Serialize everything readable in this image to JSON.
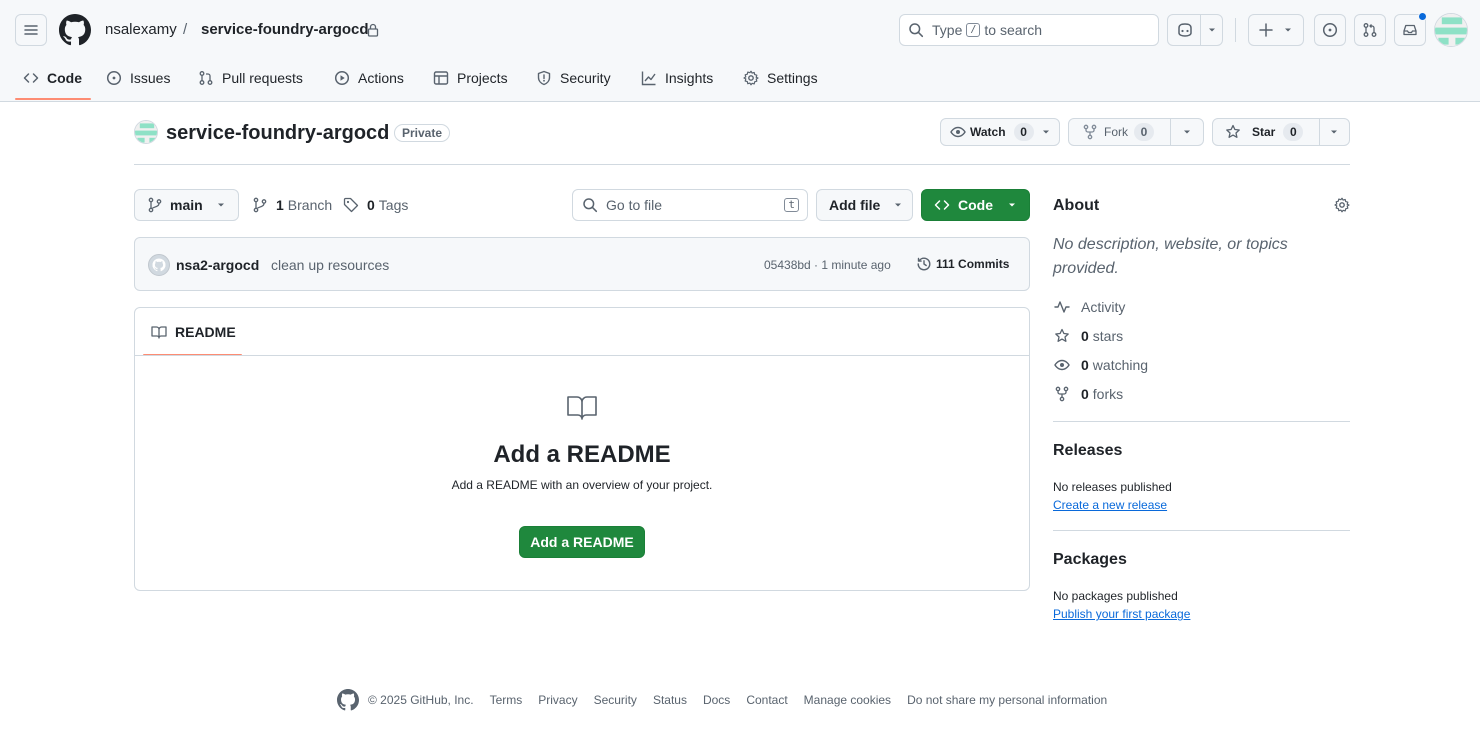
{
  "header": {
    "owner": "nsalexamy",
    "separator": "/",
    "repo": "service-foundry-argocd",
    "search_prefix": "Type",
    "search_key": "/",
    "search_suffix": "to search"
  },
  "nav": {
    "tabs": [
      {
        "label": "Code",
        "icon": "code-icon",
        "selected": true
      },
      {
        "label": "Issues",
        "icon": "issue-opened-icon"
      },
      {
        "label": "Pull requests",
        "icon": "git-pull-request-icon"
      },
      {
        "label": "Actions",
        "icon": "play-icon"
      },
      {
        "label": "Projects",
        "icon": "table-icon"
      },
      {
        "label": "Security",
        "icon": "shield-icon"
      },
      {
        "label": "Insights",
        "icon": "graph-icon"
      },
      {
        "label": "Settings",
        "icon": "gear-icon"
      }
    ]
  },
  "repo_header": {
    "name": "service-foundry-argocd",
    "visibility": "Private",
    "watch_label": "Watch",
    "watch_count": "0",
    "fork_label": "Fork",
    "fork_count": "0",
    "star_label": "Star",
    "star_count": "0"
  },
  "file_nav": {
    "branch": "main",
    "branch_count": "1",
    "branch_label": "Branch",
    "tag_count": "0",
    "tag_label": "Tags",
    "go_to_file_placeholder": "Go to file",
    "go_to_file_key": "t",
    "add_file_label": "Add file",
    "code_label": "Code"
  },
  "commit": {
    "author": "nsa2-argocd",
    "message": "clean up resources",
    "meta": "05438bd · 1 minute ago",
    "commits_label": "111 Commits"
  },
  "readme": {
    "tab_label": "README",
    "title": "Add a README",
    "description": "Add a README with an overview of your project.",
    "button_label": "Add a README"
  },
  "about": {
    "title": "About",
    "description": "No description, website, or topics provided.",
    "activity_label": "Activity",
    "stars_count": "0",
    "stars_label": "stars",
    "watching_count": "0",
    "watching_label": "watching",
    "forks_count": "0",
    "forks_label": "forks"
  },
  "releases": {
    "title": "Releases",
    "empty_text": "No releases published",
    "link": "Create a new release"
  },
  "packages": {
    "title": "Packages",
    "empty_text": "No packages published",
    "link": "Publish your first package"
  },
  "footer": {
    "copyright": "© 2025 GitHub, Inc.",
    "links": [
      "Terms",
      "Privacy",
      "Security",
      "Status",
      "Docs",
      "Contact",
      "Manage cookies",
      "Do not share my personal information"
    ]
  },
  "colors": {
    "accent_green": "#1f883d",
    "link_blue": "#0969da",
    "selected_underline": "#fd8c73",
    "notification_dot": "#0969da"
  }
}
